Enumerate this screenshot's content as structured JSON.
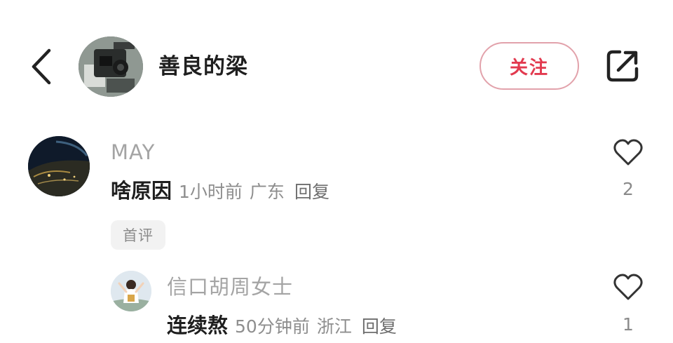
{
  "header": {
    "username": "善良的梁",
    "follow_label": "关注",
    "back_icon": "chevron-left-icon",
    "share_icon": "share-external-icon"
  },
  "comments": [
    {
      "author": "MAY",
      "text": "啥原因",
      "time": "1小时前",
      "location": "广东",
      "reply_label": "回复",
      "likes": "2",
      "tag": "首评",
      "replies": [
        {
          "author": "信口胡周女士",
          "text": "连续熬",
          "time": "50分钟前",
          "location": "浙江",
          "reply_label": "回复",
          "likes": "1"
        }
      ]
    }
  ],
  "colors": {
    "accent": "#e23a4f",
    "follow_border": "#e2a2ab",
    "muted_text": "#a4a4a4",
    "tag_bg": "#f2f2f2"
  }
}
